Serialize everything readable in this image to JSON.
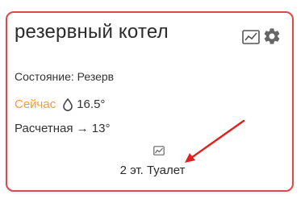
{
  "card": {
    "title": "резервный котел",
    "state": "Состояние: Резерв",
    "now_label": "Сейчас",
    "now_value": "16.5°",
    "calc_text": "Расчетная → 13°",
    "location": "2 эт. Туалет"
  },
  "icons": {
    "chart": "line-chart-icon",
    "settings": "gear-icon",
    "drop": "water-drop-icon",
    "small_chart": "line-chart-icon",
    "annotation": "red-arrow"
  },
  "colors": {
    "border": "#d94a4a",
    "now_label": "#f0a030",
    "arrow": "#e02020",
    "text": "#2b2b2b"
  }
}
